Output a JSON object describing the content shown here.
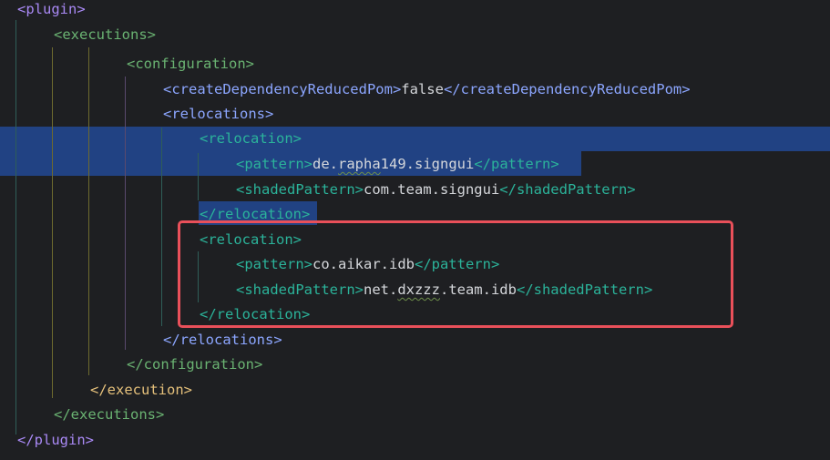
{
  "code": {
    "plugin_open": "<plugin>",
    "executions_open": "<executions>",
    "configuration_open": "<configuration>",
    "cdrp_open": "<createDependencyReducedPom>",
    "cdrp_value": "false",
    "cdrp_close": "</createDependencyReducedPom>",
    "relocations_open": "<relocations>",
    "reloc1_open": "<relocation>",
    "pattern1_open": "<pattern>",
    "pattern1_value_a": "de.",
    "pattern1_value_b": "rapha",
    "pattern1_value_c": "149.signgui",
    "pattern1_close": "</pattern>",
    "shaded1_open": "<shadedPattern>",
    "shaded1_value": "com.team.signgui",
    "shaded1_close": "</shadedPattern>",
    "reloc1_close": "</relocation>",
    "reloc2_open": "<relocation>",
    "pattern2_open": "<pattern>",
    "pattern2_value": "co.aikar.idb",
    "pattern2_close": "</pattern>",
    "shaded2_open": "<shadedPattern>",
    "shaded2_value_a": "net.",
    "shaded2_value_b": "dxzzz",
    "shaded2_value_c": ".team.idb",
    "shaded2_close": "</shadedPattern>",
    "reloc2_close": "</relocation>",
    "relocations_close": "</relocations>",
    "configuration_close": "</configuration>",
    "execution_close": "</execution>",
    "executions_close": "</executions>",
    "plugin_close": "</plugin>"
  },
  "colors": {
    "background": "#1e1f22",
    "selection": "#214283",
    "highlight_box": "#e9505a"
  }
}
